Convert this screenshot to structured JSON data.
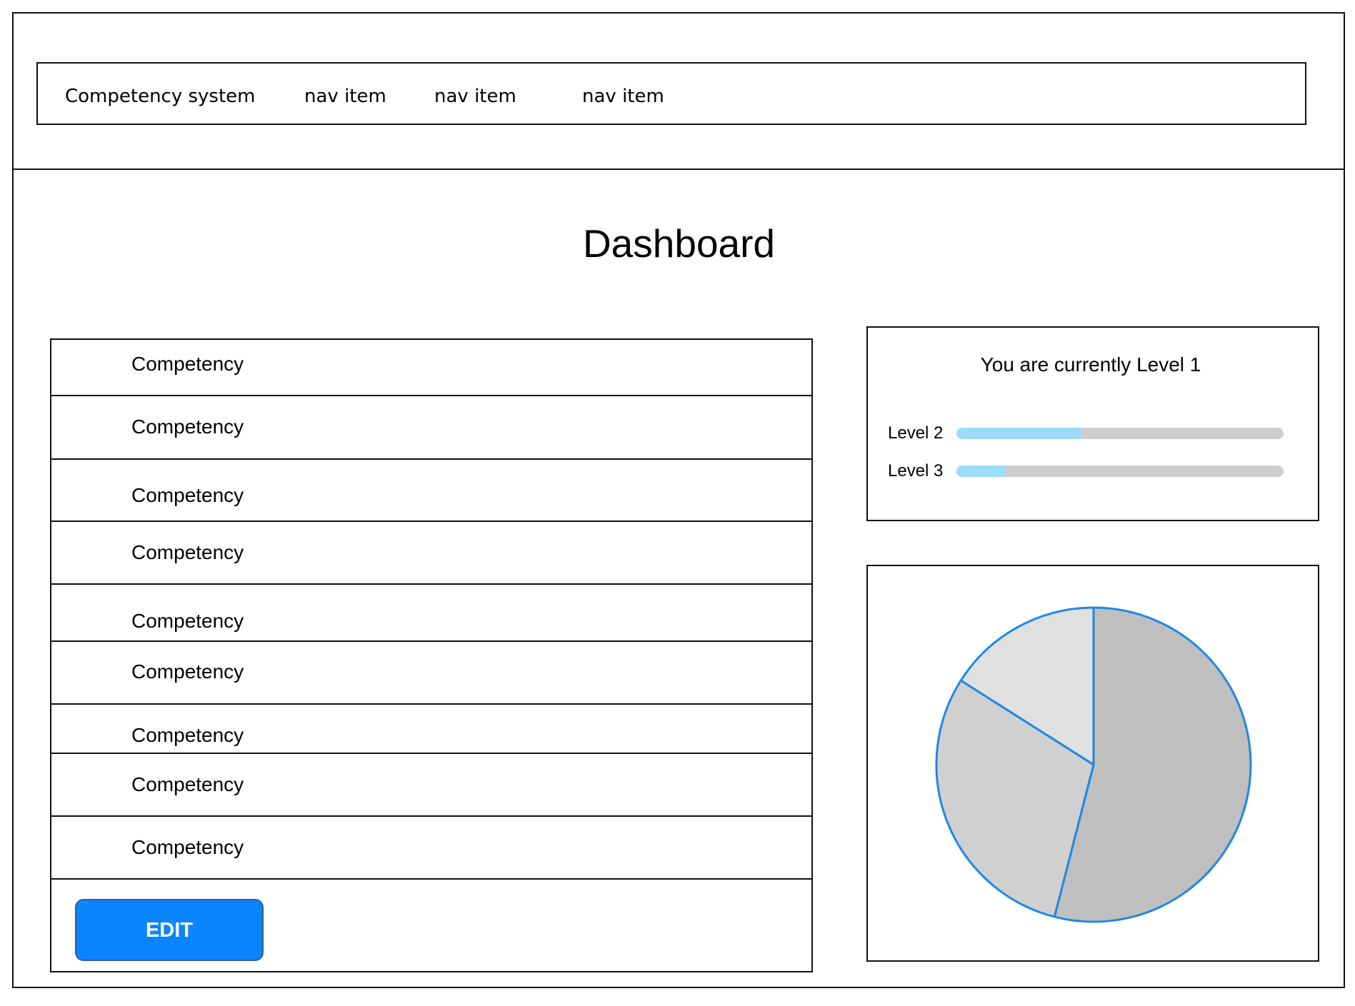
{
  "navbar": {
    "brand": "Competency system",
    "items": [
      "nav item",
      "nav item",
      "nav item"
    ]
  },
  "page": {
    "title": "Dashboard"
  },
  "competencies": [
    "Competency",
    "Competency",
    "Competency",
    "Competency",
    "Competency",
    "Competency",
    "Competency",
    "Competency",
    "Competency"
  ],
  "edit_button_label": "EDIT",
  "level_card": {
    "status_text": "You are currently Level 1",
    "progress": [
      {
        "label": "Level 2",
        "percent": 38
      },
      {
        "label": "Level 3",
        "percent": 15
      }
    ]
  },
  "colors": {
    "accent": "#0a84ff",
    "progress_fill": "#9ddcf9",
    "progress_track": "#cdcdcd",
    "pie_outline": "#1e88e5"
  },
  "chart_data": {
    "type": "pie",
    "values": [
      54,
      30,
      16
    ],
    "colors": [
      "#bfbfbf",
      "#d0d0d0",
      "#e0e0e0"
    ],
    "start": "12 o'clock",
    "direction": "clockwise"
  }
}
